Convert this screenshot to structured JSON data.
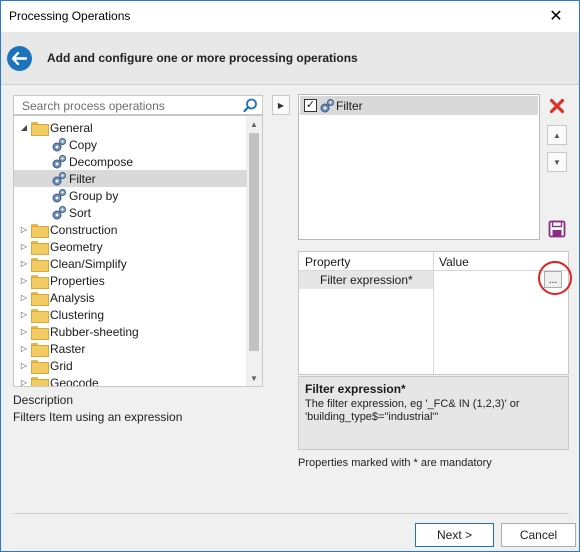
{
  "window": {
    "title": "Processing Operations",
    "close_glyph": "✕"
  },
  "header": {
    "heading": "Add and configure one or more processing operations",
    "back_icon": "arrow-left-icon",
    "accent": "#1e73be"
  },
  "search": {
    "placeholder": "Search process operations"
  },
  "tree": {
    "items": [
      {
        "label": "General",
        "type": "folder",
        "expanded": true,
        "level": 0
      },
      {
        "label": "Copy",
        "type": "operation",
        "level": 1
      },
      {
        "label": "Decompose",
        "type": "operation",
        "level": 1
      },
      {
        "label": "Filter",
        "type": "operation",
        "level": 1,
        "selected": true
      },
      {
        "label": "Group by",
        "type": "operation",
        "level": 1
      },
      {
        "label": "Sort",
        "type": "operation",
        "level": 1
      },
      {
        "label": "Construction",
        "type": "folder",
        "expanded": false,
        "level": 0
      },
      {
        "label": "Geometry",
        "type": "folder",
        "expanded": false,
        "level": 0
      },
      {
        "label": "Clean/Simplify",
        "type": "folder",
        "expanded": false,
        "level": 0
      },
      {
        "label": "Properties",
        "type": "folder",
        "expanded": false,
        "level": 0
      },
      {
        "label": "Analysis",
        "type": "folder",
        "expanded": false,
        "level": 0
      },
      {
        "label": "Clustering",
        "type": "folder",
        "expanded": false,
        "level": 0
      },
      {
        "label": "Rubber-sheeting",
        "type": "folder",
        "expanded": false,
        "level": 0
      },
      {
        "label": "Raster",
        "type": "folder",
        "expanded": false,
        "level": 0
      },
      {
        "label": "Grid",
        "type": "folder",
        "expanded": false,
        "level": 0
      },
      {
        "label": "Geocode",
        "type": "folder",
        "expanded": false,
        "level": 0
      }
    ]
  },
  "description": {
    "label": "Description",
    "text": "Filters Item using an expression"
  },
  "operations": {
    "items": [
      {
        "label": "Filter",
        "checked": true
      }
    ]
  },
  "properties": {
    "col_property": "Property",
    "col_value": "Value",
    "rows": [
      {
        "name": "Filter expression*",
        "value": "",
        "button": "..."
      }
    ],
    "help_title": "Filter expression*",
    "help_text": "The filter expression, eg '_FC& IN (1,2,3)' or 'building_type$=\"industrial\"'",
    "mandatory_note": "Properties marked with * are mandatory"
  },
  "footer": {
    "next": "Next >",
    "cancel": "Cancel"
  },
  "colors": {
    "delete": "#d9322c",
    "save": "#8a2d86",
    "highlight": "#e02020"
  }
}
